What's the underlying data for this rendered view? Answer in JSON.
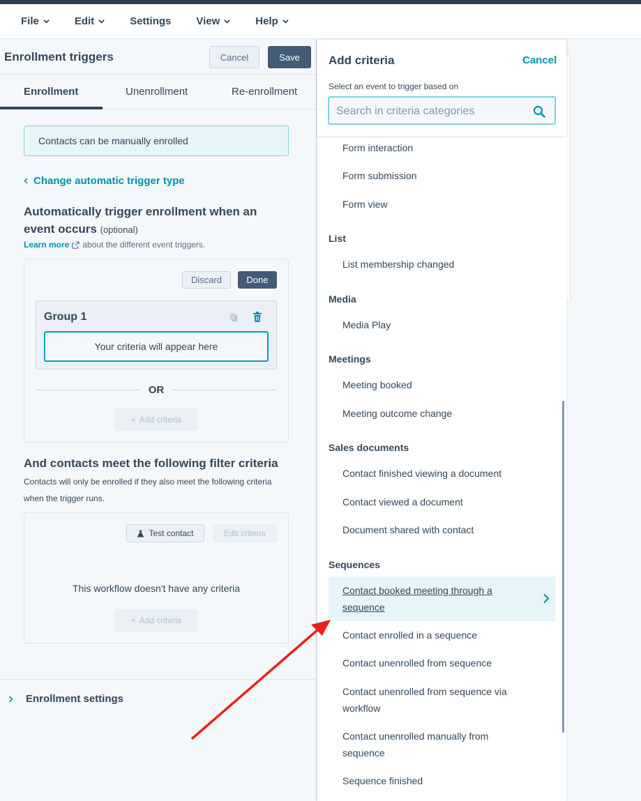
{
  "menu": {
    "file": "File",
    "edit": "Edit",
    "settings": "Settings",
    "view": "View",
    "help": "Help"
  },
  "left_panel": {
    "title": "Enrollment triggers",
    "cancel_label": "Cancel",
    "save_label": "Save",
    "tabs": [
      "Enrollment",
      "Unenrollment",
      "Re-enrollment"
    ],
    "active_tab": "Enrollment",
    "info_text": "Contacts can be manually enrolled",
    "change_trigger_link": "Change automatic trigger type",
    "auto_heading": "Automatically trigger enrollment when an event occurs",
    "optional_label": "(optional)",
    "learn_more": "Learn more",
    "learn_more_suffix": "about the different event triggers.",
    "trigger_box": {
      "discard_label": "Discard",
      "done_label": "Done",
      "group_title": "Group 1",
      "criteria_placeholder": "Your criteria will appear here",
      "or_label": "OR",
      "add_criteria_label": "Add criteria"
    },
    "filter_heading": "And contacts meet the following filter criteria",
    "filter_description": "Contacts will only be enrolled if they also meet the following criteria when the trigger runs.",
    "filter_box": {
      "test_contact_label": "Test contact",
      "edit_criteria_label": "Edit criteria",
      "empty_text": "This workflow doesn't have any criteria",
      "add_criteria_label": "Add criteria"
    },
    "enrollment_settings": "Enrollment settings"
  },
  "right_panel": {
    "title": "Add criteria",
    "cancel_label": "Cancel",
    "hint": "Select an event to trigger based on",
    "search_placeholder": "Search in criteria categories",
    "search_value": "",
    "items_form": [
      "Form interaction",
      "Form submission",
      "Form view"
    ],
    "cat_list": "List",
    "items_list": [
      "List membership changed"
    ],
    "cat_media": "Media",
    "items_media": [
      "Media Play"
    ],
    "cat_meetings": "Meetings",
    "items_meetings": [
      "Meeting booked",
      "Meeting outcome change"
    ],
    "cat_sales_documents": "Sales documents",
    "items_sales_documents": [
      "Contact finished viewing a document",
      "Contact viewed a document",
      "Document shared with contact"
    ],
    "cat_sequences": "Sequences",
    "highlighted_item": "Contact booked meeting through a sequence",
    "items_sequences": [
      "Contact enrolled in a sequence",
      "Contact unenrolled from sequence",
      "Contact unenrolled from sequence via workflow",
      "Contact unenrolled manually from sequence",
      "Sequence finished"
    ]
  },
  "colors": {
    "accent": "#0091ae",
    "primary_button": "#425b76",
    "highlight_bg": "#e5f5f8",
    "arrow": "#e8231c"
  }
}
